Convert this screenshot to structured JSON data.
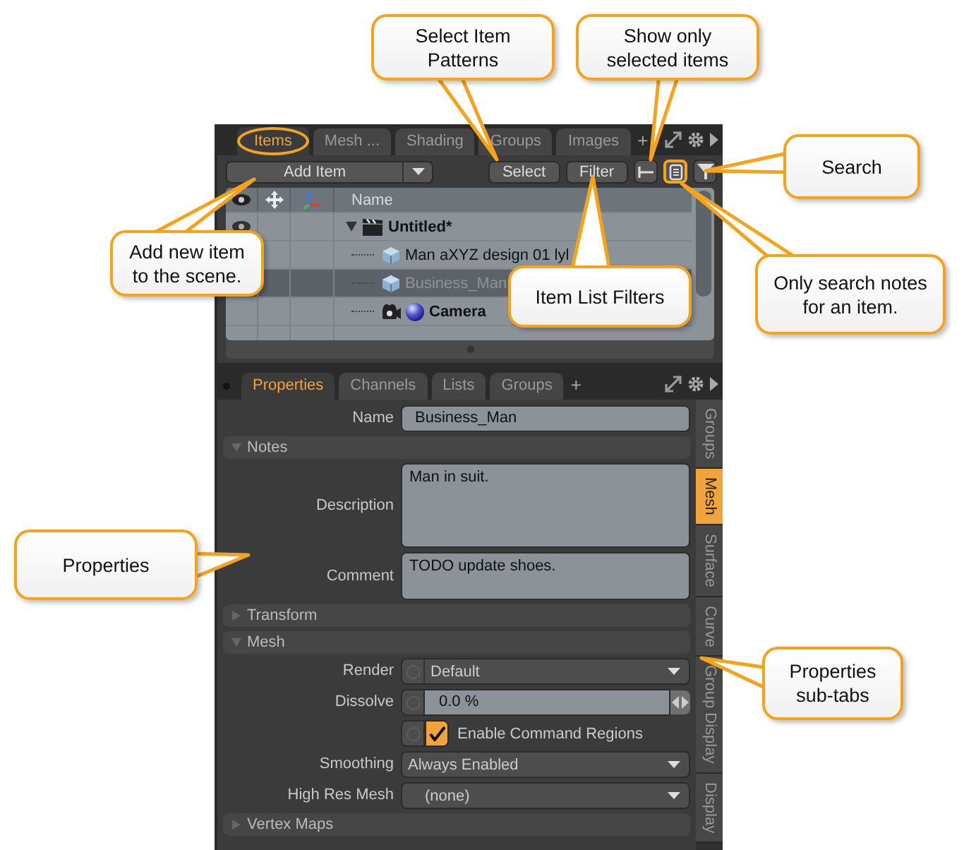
{
  "callouts": [
    {
      "text": "Select Item Patterns"
    },
    {
      "text": "Show only selected items"
    },
    {
      "text": "Search"
    },
    {
      "text": "Add new item to the scene."
    },
    {
      "text": "Item List Filters"
    },
    {
      "text": "Only search notes for an item."
    },
    {
      "text": "Properties"
    },
    {
      "text": "Properties sub-tabs"
    }
  ],
  "top_tabs": [
    {
      "label": "Items",
      "selected": true,
      "highlighted": true
    },
    {
      "label": "Mesh ...",
      "selected": false,
      "highlighted": false
    },
    {
      "label": "Shading",
      "selected": false,
      "highlighted": false
    },
    {
      "label": "Groups",
      "selected": false,
      "highlighted": false
    },
    {
      "label": "Images",
      "selected": false,
      "highlighted": false
    }
  ],
  "top_add_tab": "+",
  "toolbar": {
    "add_button": "Add Item",
    "select_button": "Select",
    "filter_button": "Filter",
    "icon_buttons": [
      {
        "kind": "show-selected",
        "highlighted": false
      },
      {
        "kind": "notes",
        "highlighted": true
      },
      {
        "kind": "search",
        "highlighted": false
      }
    ]
  },
  "item_list": {
    "name_column": "Name",
    "rows": [
      {
        "label": "Untitled*",
        "kind": "scene",
        "bold": true,
        "selected": false,
        "expanded": true,
        "children": [
          {
            "label": "Man aXYZ design 01 lyl",
            "kind": "mesh",
            "bold": false,
            "selected": false
          },
          {
            "label": "Business_Man",
            "kind": "mesh",
            "bold": false,
            "selected": true
          },
          {
            "label": "Camera",
            "kind": "camera",
            "bold": true,
            "selected": false
          }
        ]
      }
    ]
  },
  "property_tabs": [
    {
      "label": "Properties",
      "selected": true
    },
    {
      "label": "Channels",
      "selected": false
    },
    {
      "label": "Lists",
      "selected": false
    },
    {
      "label": "Groups",
      "selected": false
    }
  ],
  "property_add_tab": "+",
  "name_field": {
    "label": "Name",
    "value": "Business_Man"
  },
  "sections": [
    {
      "title": "Notes",
      "expanded": true,
      "fields": [
        {
          "kind": "tall-text",
          "label": "Description",
          "value": "Man in suit."
        },
        {
          "kind": "text",
          "label": "Comment",
          "value": "TODO update shoes."
        }
      ]
    },
    {
      "title": "Transform",
      "expanded": false
    },
    {
      "title": "Mesh",
      "expanded": true,
      "fields": [
        {
          "kind": "dropdown",
          "label": "Render",
          "value": "Default",
          "toggle": true,
          "indented": false
        },
        {
          "kind": "number",
          "label": "Dissolve",
          "value": "0.0 %"
        },
        {
          "kind": "checkbox",
          "label": "Enable Command Regions",
          "checked": true
        },
        {
          "kind": "dropdown",
          "label": "Smoothing",
          "value": "Always Enabled",
          "toggle": false,
          "indented": false
        },
        {
          "kind": "dropdown",
          "label": "High Res Mesh",
          "value": "(none)",
          "toggle": false,
          "indented": true
        }
      ]
    },
    {
      "title": "Vertex Maps",
      "expanded": false
    }
  ],
  "side_tabs": [
    {
      "label": "Groups",
      "selected": false
    },
    {
      "label": "Mesh",
      "selected": true
    },
    {
      "label": "Surface",
      "selected": false
    },
    {
      "label": "Curve",
      "selected": false
    },
    {
      "label": "Group Display",
      "selected": false
    },
    {
      "label": "Display",
      "selected": false
    }
  ]
}
